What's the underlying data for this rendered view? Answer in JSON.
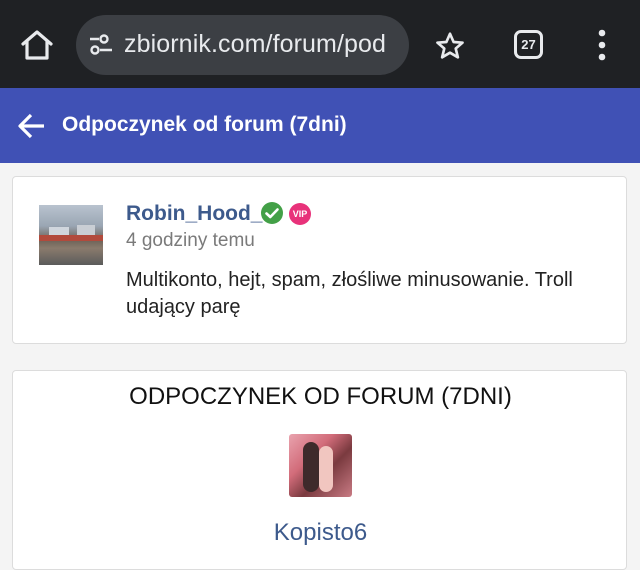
{
  "browser": {
    "url": "zbiornik.com/forum/pod",
    "tab_count": "27"
  },
  "header": {
    "title": "Odpoczynek od forum (7dni)"
  },
  "post": {
    "username": "Robin_Hood_",
    "vip_label": "VIP",
    "time": "4 godziny temu",
    "body": "Multikonto, hejt, spam, złośliwe minusowanie. Troll udający parę"
  },
  "list": {
    "title": "ODPOCZYNEK OD FORUM (7DNI)",
    "users": [
      {
        "name": "Kopisto6"
      }
    ]
  },
  "colors": {
    "header_bg": "#4051b5",
    "link": "#3d5a8c",
    "verified": "#43a047",
    "vip": "#e8327a"
  },
  "icons": [
    "home-icon",
    "tune-icon",
    "star-icon",
    "tab-switcher-icon",
    "more-vert-icon",
    "arrow-back-icon",
    "verified-icon"
  ]
}
